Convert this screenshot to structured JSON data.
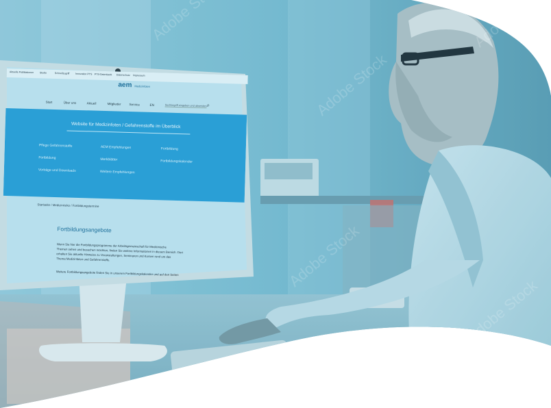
{
  "browser": {
    "bookmarks": [
      "Aktuelle Publikationen",
      "Studie",
      "Schnellzugriff",
      "Innovation PTS",
      "PTS-Datenbank",
      "Datenschutz",
      "Impressum"
    ]
  },
  "site": {
    "logo_text": "aem",
    "logo_subtitle": "Medizinfoten",
    "nav": [
      "Start",
      "Über uns",
      "Aktuell",
      "Mitglieder",
      "Service",
      "EN"
    ],
    "search_placeholder": "Suchbegriff eingeben und absenden",
    "hero_title": "Website für Medizinfoten / Gefahrenstoffe im Überblick",
    "hero_links": [
      [
        "Pflege Gefahrenstoffe",
        "Fortbildung",
        "Vorträge und Downloads"
      ],
      [
        "AEM Empfehlungen",
        "Merkblätter",
        "Weitere Empfehlungen"
      ],
      [
        "Fortbildung",
        "Fortbildungskalender"
      ]
    ],
    "breadcrumb": "Startseite / Medizinrisiko / Fortbildungstermine",
    "content_title": "Fortbildungsangebote",
    "content_lines": [
      "Wenn Sie hier die Fortbildungsprogramme der Arbeitsgemeinschaft für Medizinische",
      "Themen sehen und besuchen möchten, finden Sie weitere Informationen in diesem Bereich. Dort",
      "erhalten Sie aktuelle Hinweise zu Veranstaltungen, Seminaren und Kursen rund um das",
      "Thema Medizinfoten und Gefahrenstoffe.",
      "Weitere Fortbildungsangebote finden Sie in unserem Fortbildungskalender und auf den Seiten"
    ]
  },
  "watermark": "Adobe Stock",
  "colors": {
    "teal_overlay": "#4a9fb8",
    "screen_blue": "#2a9fd6",
    "brand_blue": "#1d6f9a"
  }
}
